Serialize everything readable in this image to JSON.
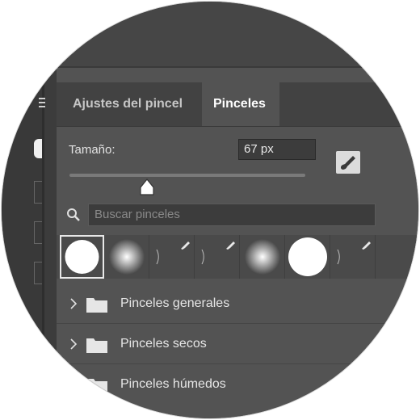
{
  "tabs": [
    {
      "label": "Ajustes del pincel",
      "active": false
    },
    {
      "label": "Pinceles",
      "active": true
    }
  ],
  "size": {
    "label": "Tamaño:",
    "value": "67 px",
    "slider_fraction": 0.33
  },
  "search": {
    "placeholder": "Buscar pinceles"
  },
  "presets": [
    {
      "kind": "hard-round",
      "selected": true
    },
    {
      "kind": "soft-round",
      "selected": false
    },
    {
      "kind": "stroke",
      "selected": false
    },
    {
      "kind": "stroke",
      "selected": false
    },
    {
      "kind": "soft-round",
      "selected": false
    },
    {
      "kind": "hard-round",
      "selected": false
    },
    {
      "kind": "stroke",
      "selected": false
    }
  ],
  "folders": [
    {
      "label": "Pinceles generales"
    },
    {
      "label": "Pinceles secos"
    },
    {
      "label": "Pinceles húmedos"
    }
  ],
  "icons": {
    "panel_menu": "panel-menu-icon",
    "brush_settings": "brush-settings-icon",
    "search": "search-icon",
    "chevron": "chevron-right-icon",
    "folder": "folder-icon"
  },
  "colors": {
    "panel_bg": "#535353",
    "tab_bar_bg": "#424242",
    "input_bg": "#3c3c3c",
    "text": "#e6e6e6"
  }
}
